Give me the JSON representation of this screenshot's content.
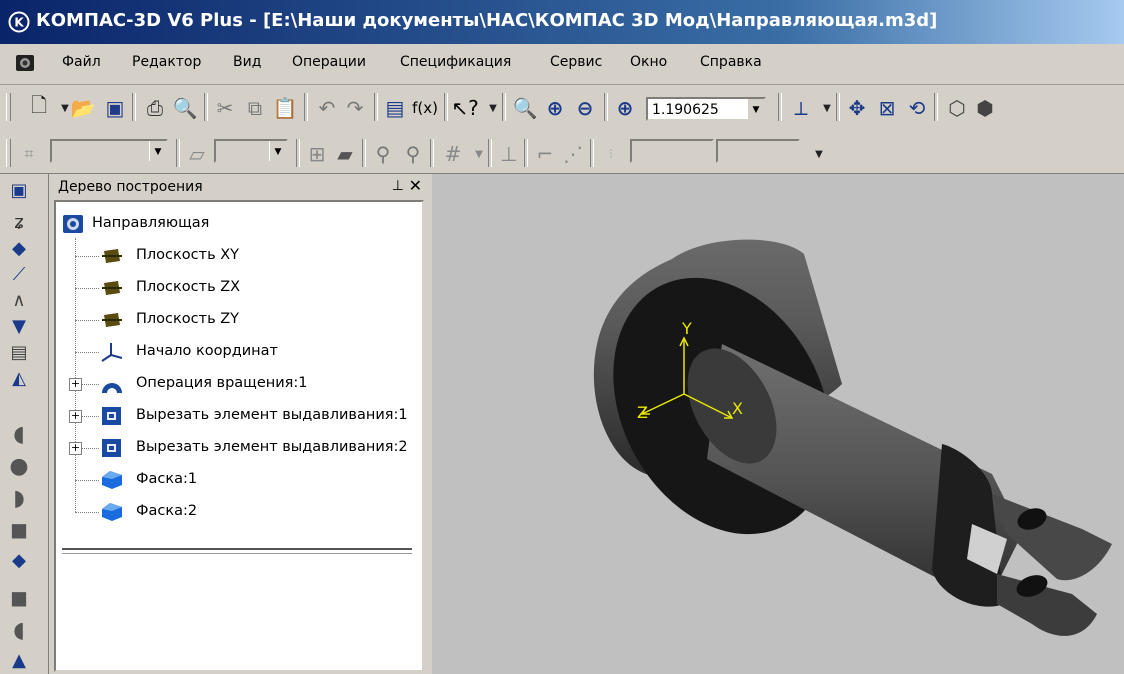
{
  "window": {
    "title": "КОМПАС-3D V6 Plus - [E:\\Наши документы\\НАС\\КОМПАС 3D Мод\\Направляющая.m3d]"
  },
  "menu": {
    "items": [
      "Файл",
      "Редактор",
      "Вид",
      "Операции",
      "Спецификация",
      "Сервис",
      "Окно",
      "Справка"
    ]
  },
  "toolbar": {
    "zoom_value": "1.190625"
  },
  "tree_panel": {
    "title": "Дерево построения",
    "pin_icon": "pin-icon",
    "close_icon": "close-icon",
    "root": "Направляющая",
    "items": [
      {
        "label": "Плоскость XY",
        "icon": "plane-icon",
        "expandable": false
      },
      {
        "label": "Плоскость ZX",
        "icon": "plane-icon",
        "expandable": false
      },
      {
        "label": "Плоскость ZY",
        "icon": "plane-icon",
        "expandable": false
      },
      {
        "label": "Начало координат",
        "icon": "origin-icon",
        "expandable": false
      },
      {
        "label": "Операция вращения:1",
        "icon": "revolve-icon",
        "expandable": true
      },
      {
        "label": "Вырезать элемент выдавливания:1",
        "icon": "cut-extrude-icon",
        "expandable": true
      },
      {
        "label": "Вырезать элемент выдавливания:2",
        "icon": "cut-extrude-icon",
        "expandable": true
      },
      {
        "label": "Фаска:1",
        "icon": "chamfer-icon",
        "expandable": false
      },
      {
        "label": "Фаска:2",
        "icon": "chamfer-icon",
        "expandable": false
      }
    ]
  },
  "viewport": {
    "axis_labels": {
      "y": "Y",
      "z": "Z",
      "x": "X"
    },
    "axis_color": "#e8e800",
    "background": "#c0c0c0"
  },
  "colors": {
    "titlebar_start": "#0a246a",
    "titlebar_end": "#a6caf0",
    "face": "#d4d0c8"
  }
}
